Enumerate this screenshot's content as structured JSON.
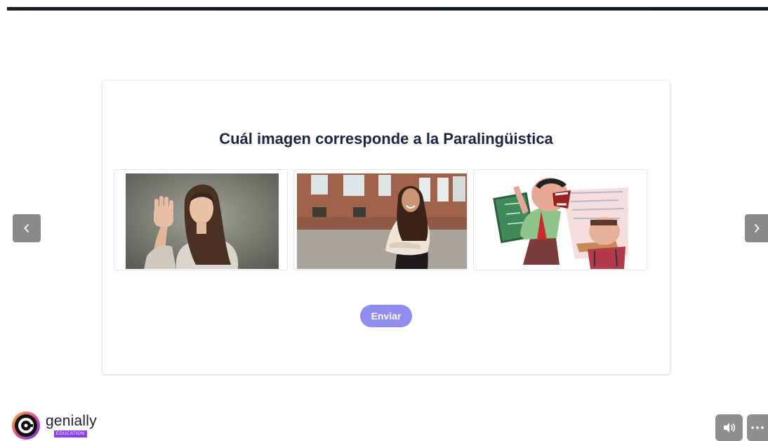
{
  "question": {
    "title": "Cuál imagen corresponde a la Paralingüistica"
  },
  "options": [
    {
      "icon": "photo-woman-hand-gesture"
    },
    {
      "icon": "photo-woman-smiling-street"
    },
    {
      "icon": "cartoon-teacher-shouting"
    }
  ],
  "send_label": "Enviar",
  "navigation": {
    "prev_icon": "chevron-left-icon",
    "next_icon": "chevron-right-icon"
  },
  "brand": {
    "name": "genially",
    "badge": "EDUCATION"
  },
  "controls": {
    "sound_icon": "volume-icon",
    "more_icon": "more-icon"
  },
  "colors": {
    "accent": "#8f8df0",
    "title": "#1b2543",
    "nav": "#8a8a8a",
    "badge": "#8a3ff5"
  }
}
